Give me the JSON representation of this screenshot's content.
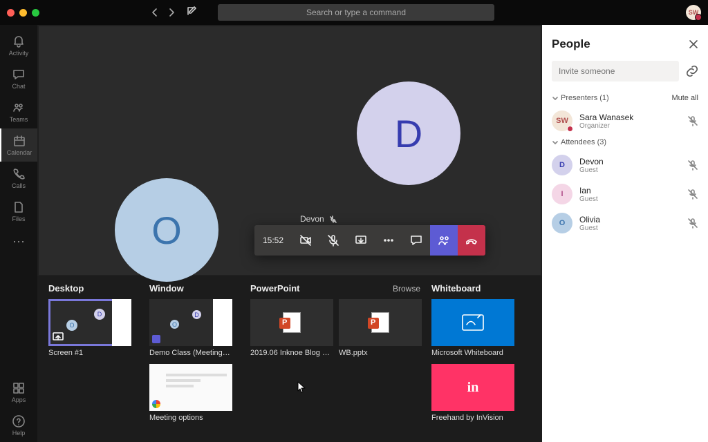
{
  "titlebar": {
    "search_placeholder": "Search or type a command",
    "user_initials": "SW"
  },
  "rail": {
    "activity": "Activity",
    "chat": "Chat",
    "teams": "Teams",
    "calendar": "Calendar",
    "calls": "Calls",
    "files": "Files",
    "apps": "Apps",
    "help": "Help"
  },
  "stage": {
    "big_d": "D",
    "big_o": "O",
    "speaker_name": "Devon",
    "call_timer": "15:52"
  },
  "tray": {
    "desktop_hdr": "Desktop",
    "window_hdr": "Window",
    "powerpoint_hdr": "PowerPoint",
    "browse": "Browse",
    "whiteboard_hdr": "Whiteboard",
    "desktop_items": [
      "Screen #1"
    ],
    "window_items": [
      "Demo Class (Meeting) | …",
      "Meeting options"
    ],
    "powerpoint_items": [
      "2019.06 Inknoe Blog Lau…",
      "WB.pptx"
    ],
    "whiteboard_items": [
      "Microsoft Whiteboard",
      "Freehand by InVision"
    ]
  },
  "panel": {
    "title": "People",
    "invite_placeholder": "Invite someone",
    "mute_all": "Mute all",
    "presenters_label": "Presenters (1)",
    "attendees_label": "Attendees (3)",
    "presenters": [
      {
        "initials": "SW",
        "name": "Sara Wanasek",
        "role": "Organizer",
        "avatar_bg": "#f3e6d8",
        "avatar_fg": "#b0504f",
        "presence": true
      }
    ],
    "attendees": [
      {
        "initials": "D",
        "name": "Devon",
        "role": "Guest",
        "avatar_bg": "#d3d1ec",
        "avatar_fg": "#363caf"
      },
      {
        "initials": "I",
        "name": "Ian",
        "role": "Guest",
        "avatar_bg": "#f4d6e6",
        "avatar_fg": "#b04f8a"
      },
      {
        "initials": "O",
        "name": "Olivia",
        "role": "Guest",
        "avatar_bg": "#b6cee5",
        "avatar_fg": "#3c74ad"
      }
    ]
  }
}
